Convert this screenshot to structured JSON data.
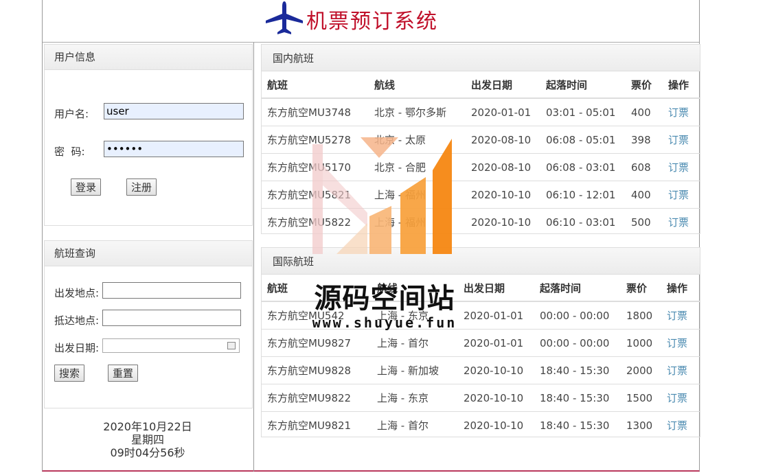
{
  "header": {
    "title": "机票预订系统"
  },
  "user_panel": {
    "title": "用户信息",
    "username_label": "用户名:",
    "username_value": "user",
    "password_label": "密  码:",
    "password_value": "••••••",
    "login_label": "登录",
    "register_label": "注册"
  },
  "search_panel": {
    "title": "航班查询",
    "from_label": "出发地点:",
    "to_label": "抵达地点:",
    "date_label": "出发日期:",
    "search_label": "搜索",
    "reset_label": "重置"
  },
  "clock": {
    "date": "2020年10月22日",
    "weekday": "星期四",
    "time": "09时04分56秒"
  },
  "domestic": {
    "title": "国内航班",
    "columns": [
      "航班",
      "航线",
      "出发日期",
      "起落时间",
      "票价",
      "操作"
    ],
    "rows": [
      [
        "东方航空MU3748",
        "北京 - 鄂尔多斯",
        "2020-01-01",
        "03:01 - 05:01",
        "400",
        "订票"
      ],
      [
        "东方航空MU5278",
        "北京 - 太原",
        "2020-08-10",
        "06:08 - 05:01",
        "398",
        "订票"
      ],
      [
        "东方航空MU5170",
        "北京 - 合肥",
        "2020-08-10",
        "06:08 - 03:01",
        "608",
        "订票"
      ],
      [
        "东方航空MU5821",
        "上海 - 福州",
        "2020-10-10",
        "06:10 - 12:01",
        "400",
        "订票"
      ],
      [
        "东方航空MU5822",
        "上海 - 福州",
        "2020-10-10",
        "06:10 - 03:01",
        "500",
        "订票"
      ]
    ]
  },
  "international": {
    "title": "国际航班",
    "columns": [
      "航班",
      "航线",
      "出发日期",
      "起落时间",
      "票价",
      "操作"
    ],
    "rows": [
      [
        "东方航空MU542",
        "上海 - 东京",
        "2020-01-01",
        "00:00 - 00:00",
        "1800",
        "订票"
      ],
      [
        "东方航空MU9827",
        "上海 - 首尔",
        "2020-01-01",
        "00:00 - 00:00",
        "1000",
        "订票"
      ],
      [
        "东方航空MU9828",
        "上海 - 新加坡",
        "2020-10-10",
        "18:40 - 15:30",
        "2000",
        "订票"
      ],
      [
        "东方航空MU9822",
        "上海 - 东京",
        "2020-10-10",
        "18:40 - 15:30",
        "1500",
        "订票"
      ],
      [
        "东方航空MU9821",
        "上海 - 首尔",
        "2020-10-10",
        "18:40 - 15:30",
        "1300",
        "订票"
      ]
    ]
  },
  "watermark": {
    "text": "源码空间站",
    "url": "www.shuyue.fun"
  }
}
